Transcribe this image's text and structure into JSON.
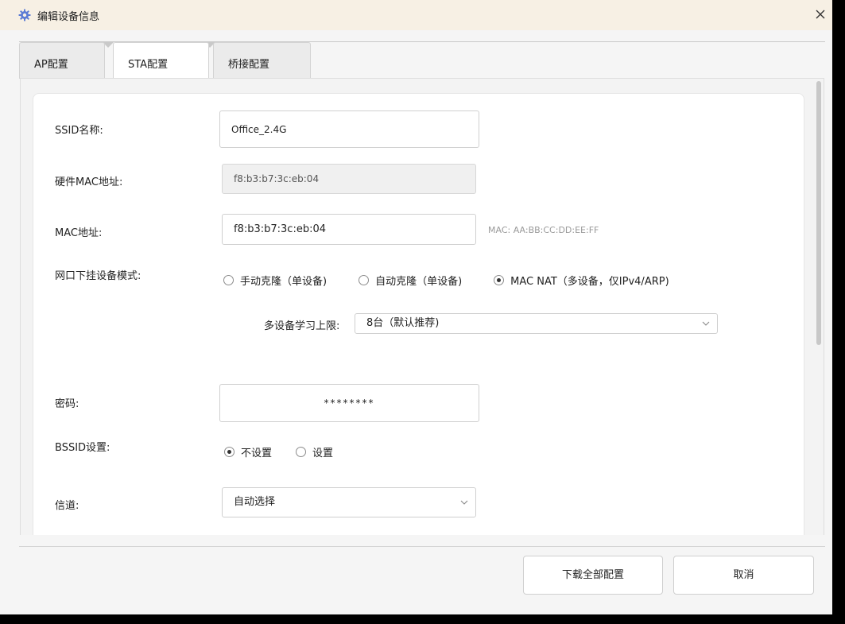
{
  "window": {
    "title": "编辑设备信息",
    "icon": "gear-icon",
    "close_icon": "close-icon",
    "accent_color": "#5b7bd5"
  },
  "tabs": [
    {
      "label": "AP配置",
      "active": false
    },
    {
      "label": "STA配置",
      "active": true
    },
    {
      "label": "桥接配置",
      "active": false
    }
  ],
  "form": {
    "ssid": {
      "label": "SSID名称:",
      "value": "Office_2.4G"
    },
    "hw_mac": {
      "label": "硬件MAC地址:",
      "value": "f8:b3:b7:3c:eb:04"
    },
    "mac": {
      "label": "MAC地址:",
      "value": "f8:b3:b7:3c:eb:04",
      "hint": "MAC: AA:BB:CC:DD:EE:FF"
    },
    "mode": {
      "label": "网口下挂设备模式:",
      "options": [
        {
          "label": "手动克隆（单设备)",
          "checked": false
        },
        {
          "label": "自动克隆（单设备)",
          "checked": false
        },
        {
          "label": "MAC NAT（多设备，仅IPv4/ARP)",
          "checked": true
        }
      ]
    },
    "learn_limit": {
      "label": "多设备学习上限:",
      "value": "8台（默认推荐)"
    },
    "password": {
      "label": "密码:",
      "value": "********"
    },
    "bssid": {
      "label": "BSSID设置:",
      "options": [
        {
          "label": "不设置",
          "checked": true
        },
        {
          "label": "设置",
          "checked": false
        }
      ]
    },
    "channel": {
      "label": "信道:",
      "value": "自动选择"
    }
  },
  "footer": {
    "download_label": "下载全部配置",
    "cancel_label": "取消"
  }
}
